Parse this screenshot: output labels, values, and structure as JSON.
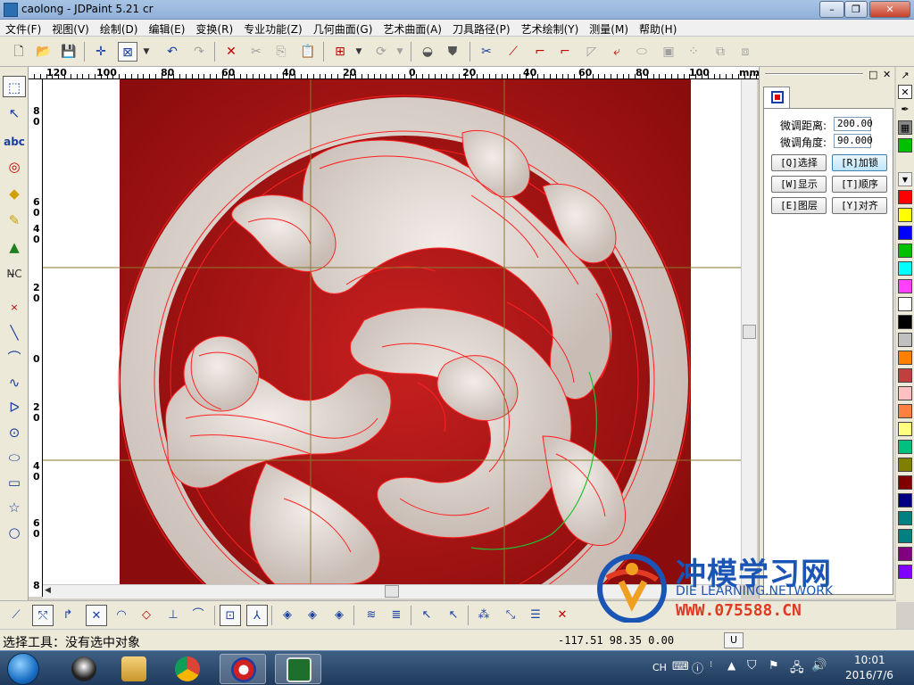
{
  "window": {
    "title": "caolong - JDPaint 5.21 cr",
    "controls": [
      "–",
      "❐",
      "✕"
    ]
  },
  "menu": [
    "文件(F)",
    "视图(V)",
    "绘制(D)",
    "编辑(E)",
    "变换(R)",
    "专业功能(Z)",
    "几何曲面(G)",
    "艺术曲面(A)",
    "刀具路径(P)",
    "艺术绘制(Y)",
    "测量(M)",
    "帮助(H)"
  ],
  "ruler": {
    "h_labels": [
      "120",
      "100",
      "80",
      "60",
      "40",
      "20",
      "0",
      "20",
      "40",
      "60",
      "80",
      "100",
      "mm"
    ],
    "v_labels": [
      "80",
      "60",
      "40",
      "20",
      "0",
      "20",
      "40",
      "60",
      "8"
    ]
  },
  "panel": {
    "fields": [
      {
        "label": "微调距离:",
        "value": "200.00"
      },
      {
        "label": "微调角度:",
        "value": "90.000"
      }
    ],
    "buttons": [
      "[Q]选择",
      "[R]加锁",
      "[W]显示",
      "[T]顺序",
      "[E]图层",
      "[Y]对齐"
    ],
    "active_button": "[R]加锁"
  },
  "palette": [
    "#00c000",
    "#ff0000",
    "#ffff00",
    "#0000ff",
    "#00c000",
    "#00ffff",
    "#ff40ff",
    "#ffffff",
    "#000000",
    "#c0c0c0",
    "#ff8000",
    "#c04040",
    "#ffc0c0",
    "#ff8040",
    "#ffff80",
    "#00c080",
    "#808000",
    "#800000",
    "#000080",
    "#008080",
    "#008080",
    "#800080",
    "#8000ff"
  ],
  "status": {
    "text": "选择工具：没有选中对象",
    "coords": "-117.51  98.35  0.00",
    "unit": "U"
  },
  "watermark": {
    "title": "冲模学习网",
    "subtitle": "DIE LEARNING.NETWORK",
    "url": "WWW.075588.CN"
  },
  "taskbar": {
    "apps": [
      "qq-icon",
      "explorer-icon",
      "chrome-icon",
      "jdpaint-icon",
      "camtasia-icon"
    ],
    "tray_lang": "CH",
    "time": "10:01",
    "date": "2016/7/6"
  },
  "colors": {
    "carving_bg": "#b01818",
    "carving_stone": "#e4dcd6",
    "path_red": "#ff2020",
    "path_green": "#20c030",
    "guide_olive": "#8a7a30"
  }
}
